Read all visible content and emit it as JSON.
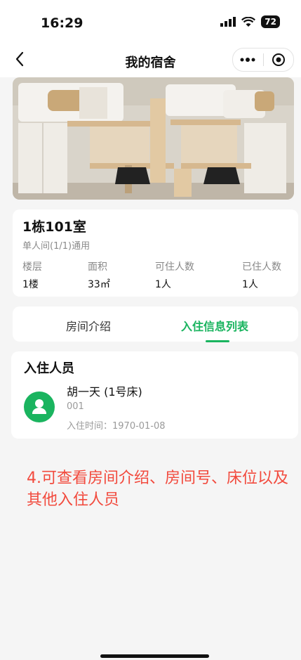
{
  "status_bar": {
    "time": "16:29",
    "battery": "72"
  },
  "nav": {
    "title": "我的宿舍"
  },
  "room": {
    "name": "1栋101室",
    "type": "单人间(1/1)通用",
    "stats": [
      {
        "label": "楼层",
        "value": "1楼"
      },
      {
        "label": "面积",
        "value": "33㎡"
      },
      {
        "label": "可住人数",
        "value": "1人"
      },
      {
        "label": "已住人数",
        "value": "1人"
      }
    ]
  },
  "tabs": [
    {
      "label": "房间介绍",
      "active": false
    },
    {
      "label": "入住信息列表",
      "active": true
    }
  ],
  "residents": {
    "title": "入住人员",
    "items": [
      {
        "name": "胡一天 (1号床)",
        "id": "001",
        "checkin": "入住时间：1970-01-08"
      }
    ]
  },
  "note": "4.可查看房间介绍、房间号、床位以及其他入住人员",
  "colors": {
    "accent": "#1ab45f",
    "note": "#f24a3d"
  }
}
